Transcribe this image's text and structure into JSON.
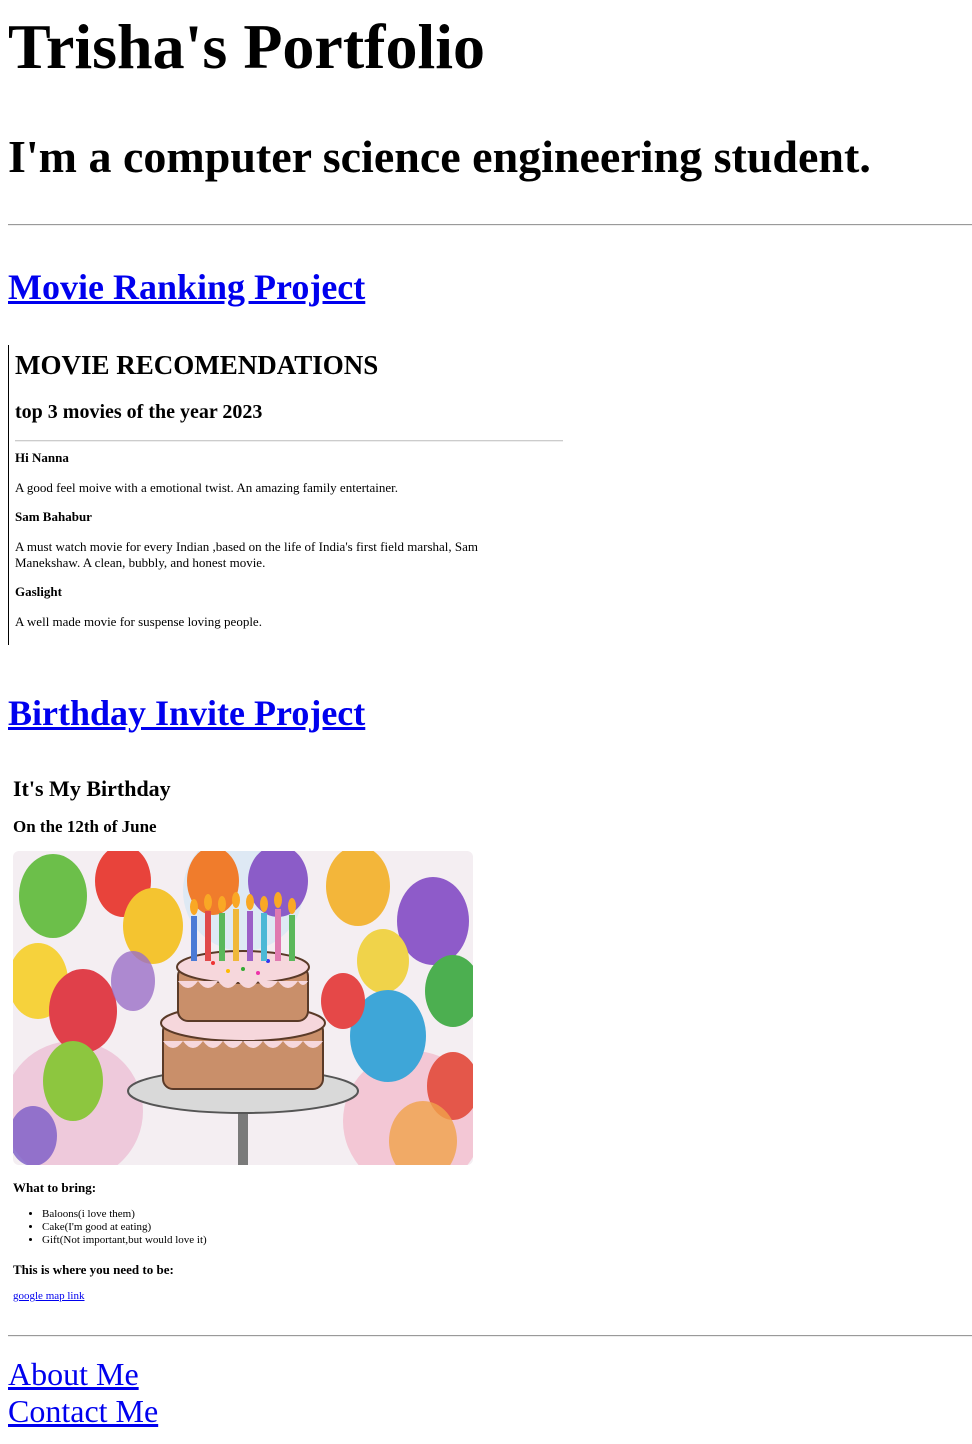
{
  "header": {
    "title": "Trisha's Portfolio",
    "subtitle": "I'm a computer science engineering student."
  },
  "projects": {
    "movie_link": "Movie Ranking Project",
    "birthday_link": "Birthday Invite Project"
  },
  "movie": {
    "heading": "MOVIE RECOMENDATIONS",
    "subheading": "top 3 movies of the year 2023",
    "items": [
      {
        "name": "Hi Nanna",
        "desc": "A good feel moive with a emotional twist. An amazing family entertainer."
      },
      {
        "name": "Sam Bahabur",
        "desc": "A must watch movie for every Indian ,based on the life of India's first field marshal, Sam Manekshaw. A clean, bubbly, and honest movie."
      },
      {
        "name": "Gaslight",
        "desc": "A well made movie for suspense loving people."
      }
    ]
  },
  "birthday": {
    "heading": "It's My Birthday",
    "date": "On the 12th of June",
    "image_icon": "birthday-cake-illustration",
    "bring_label": "What to bring:",
    "bring_items": [
      "Baloons(i love them)",
      "Cake(I'm good at eating)",
      "Gift(Not important,but would love it)"
    ],
    "where_label": "This is where you need to be:",
    "map_link": "google map link"
  },
  "footer": {
    "about": "About Me",
    "contact": "Contact Me"
  },
  "colors": {
    "link": "#0000ee",
    "text": "#000000"
  }
}
